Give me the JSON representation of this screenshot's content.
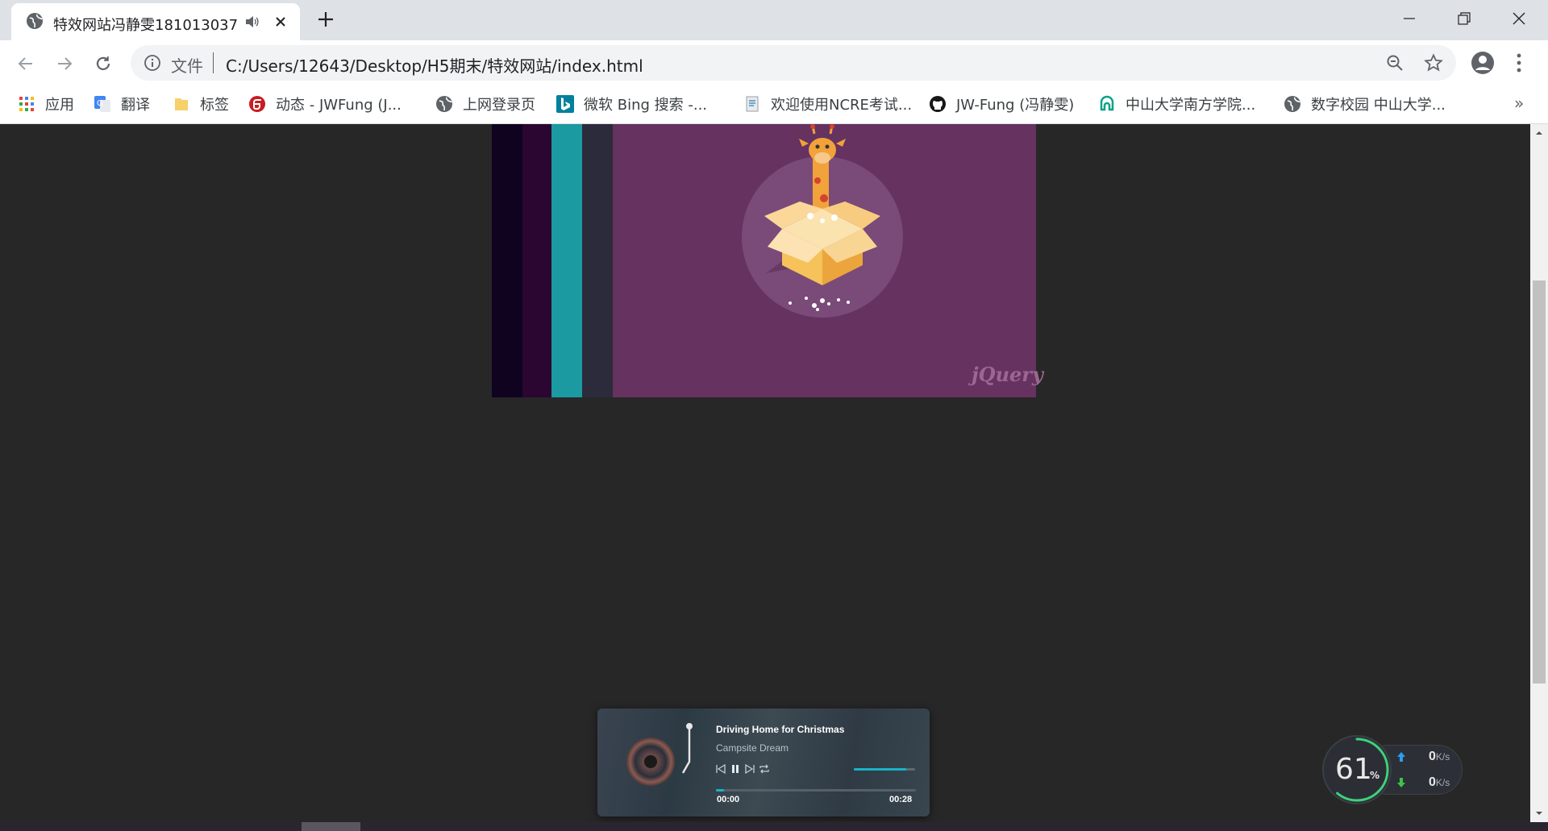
{
  "browser": {
    "tab": {
      "title": "特效网站冯静雯181013037"
    },
    "address_bar": {
      "scheme_label": "文件",
      "url": "C:/Users/12643/Desktop/H5期末/特效网站/index.html"
    },
    "bookmarks": [
      {
        "label": "应用",
        "icon": "apps-grid-icon"
      },
      {
        "label": "翻译",
        "icon": "translate-icon"
      },
      {
        "label": "标签",
        "icon": "folder-icon"
      },
      {
        "label": "动态 - JWFung (J...",
        "icon": "gitee-icon"
      },
      {
        "label": "上网登录页",
        "icon": "globe-icon"
      },
      {
        "label": "微软 Bing 搜索 -...",
        "icon": "bing-icon"
      },
      {
        "label": "欢迎使用NCRE考试...",
        "icon": "document-icon"
      },
      {
        "label": "JW-Fung (冯静雯)",
        "icon": "github-icon"
      },
      {
        "label": "中山大学南方学院...",
        "icon": "school-icon"
      },
      {
        "label": "数字校园 中山大学...",
        "icon": "globe-icon"
      }
    ],
    "overflow": "»"
  },
  "hero": {
    "logo_text": "jQuery",
    "colors": {
      "bg": "#66325f",
      "strip1": "#0f0320",
      "strip2": "#2a0630",
      "strip3": "#1b9aa1",
      "strip4": "#2b2b3b"
    }
  },
  "player": {
    "title": "Driving Home for Christmas",
    "artist": "Campsite Dream",
    "current_time": "00:00",
    "total_time": "00:28",
    "progress": 0.04,
    "volume": 0.85,
    "controls": [
      "prev-icon",
      "pause-icon",
      "next-icon",
      "repeat-icon"
    ]
  },
  "network_widget": {
    "percent": "61",
    "percent_symbol": "%",
    "upload": "0",
    "download": "0",
    "unit": "K/s",
    "ring_fraction": 0.61
  }
}
